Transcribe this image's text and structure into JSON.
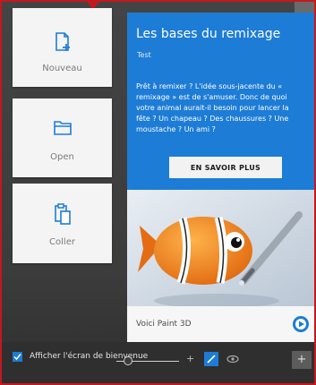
{
  "tiles": {
    "new_label": "Nouveau",
    "open_label": "Open",
    "paste_label": "Coller"
  },
  "welcome_card": {
    "title": "Les bases du remixage",
    "tag": "Test",
    "body": "Prêt à remixer ? L'idée sous-jacente du « remixage » est de s'amuser. Donc de quoi votre animal aurait-il besoin pour lancer la fête ? Un chapeau ? Des chaussures ? Une moustache ? Un ami ?",
    "button_label": "EN SAVOIR PLUS",
    "footer_caption": "Voici Paint 3D"
  },
  "options": {
    "show_welcome_label": "Afficher l'écran de bienvenue",
    "show_welcome_checked": true
  },
  "colors": {
    "accent": "#1d7cd6",
    "tile_bg": "#f4f4f4",
    "highlight_border": "#c4181f"
  }
}
